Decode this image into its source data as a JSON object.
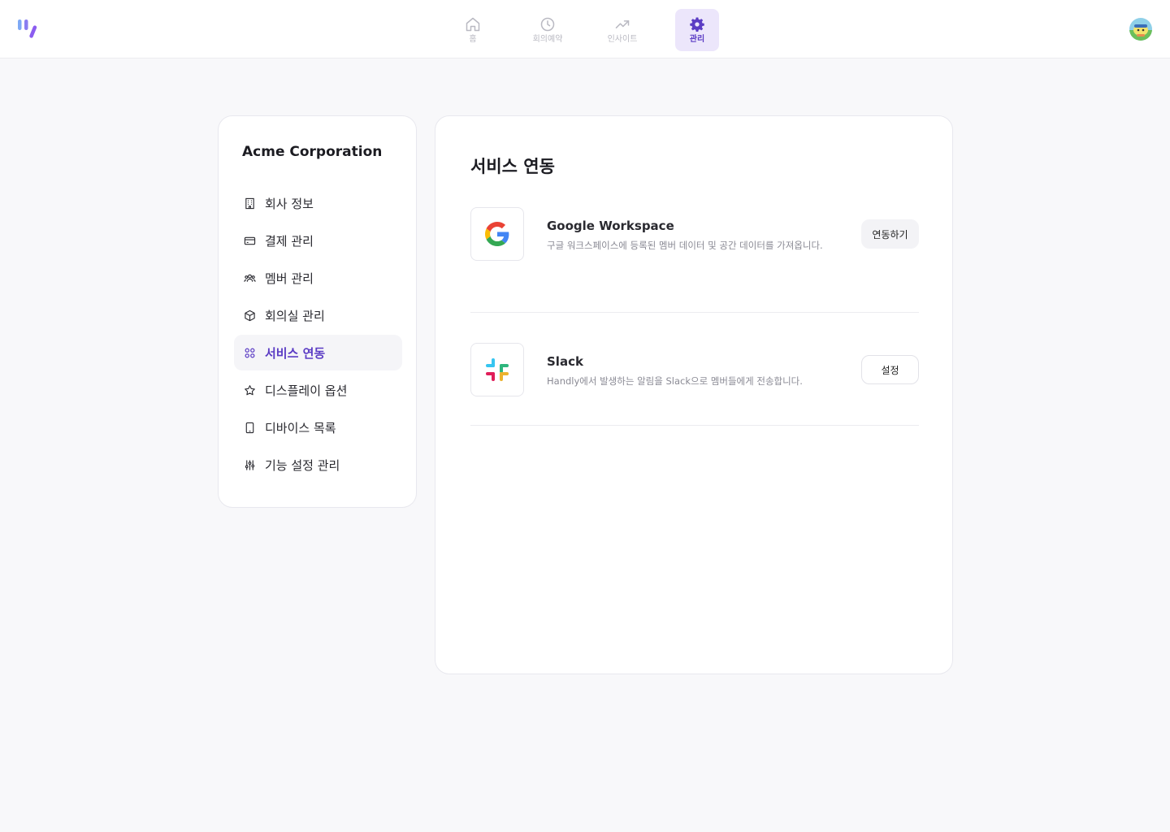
{
  "nav": {
    "tabs": [
      {
        "label": "홈",
        "icon": "home-icon"
      },
      {
        "label": "회의예약",
        "icon": "clock-icon"
      },
      {
        "label": "인사이트",
        "icon": "trending-up-icon"
      },
      {
        "label": "관리",
        "icon": "gear-icon"
      }
    ],
    "active_index": 3
  },
  "sidebar": {
    "org_name": "Acme Corporation",
    "items": [
      {
        "label": "회사 정보",
        "icon": "building-icon"
      },
      {
        "label": "결제 관리",
        "icon": "credit-card-icon"
      },
      {
        "label": "멤버 관리",
        "icon": "users-icon"
      },
      {
        "label": "회의실 관리",
        "icon": "cube-icon"
      },
      {
        "label": "서비스 연동",
        "icon": "grid-icon"
      },
      {
        "label": "디스플레이 옵션",
        "icon": "star-icon"
      },
      {
        "label": "디바이스 목록",
        "icon": "tablet-icon"
      },
      {
        "label": "기능 설정 관리",
        "icon": "sliders-icon"
      }
    ],
    "active_index": 4
  },
  "main": {
    "title": "서비스 연동",
    "services": [
      {
        "name": "Google Workspace",
        "description": "구글 워크스페이스에 등록된 멤버 데이터 및 공간 데이터를 가져옵니다.",
        "button_label": "연동하기",
        "icon": "google-logo"
      },
      {
        "name": "Slack",
        "description": "Handly에서 발생하는 알림을 Slack으로 멤버들에게 전송합니다.",
        "button_label": "설정",
        "icon": "slack-logo"
      }
    ]
  },
  "colors": {
    "accent": "#5b3cc4",
    "accent_bg": "#ece6fb",
    "page_bg": "#f8f8fa"
  }
}
